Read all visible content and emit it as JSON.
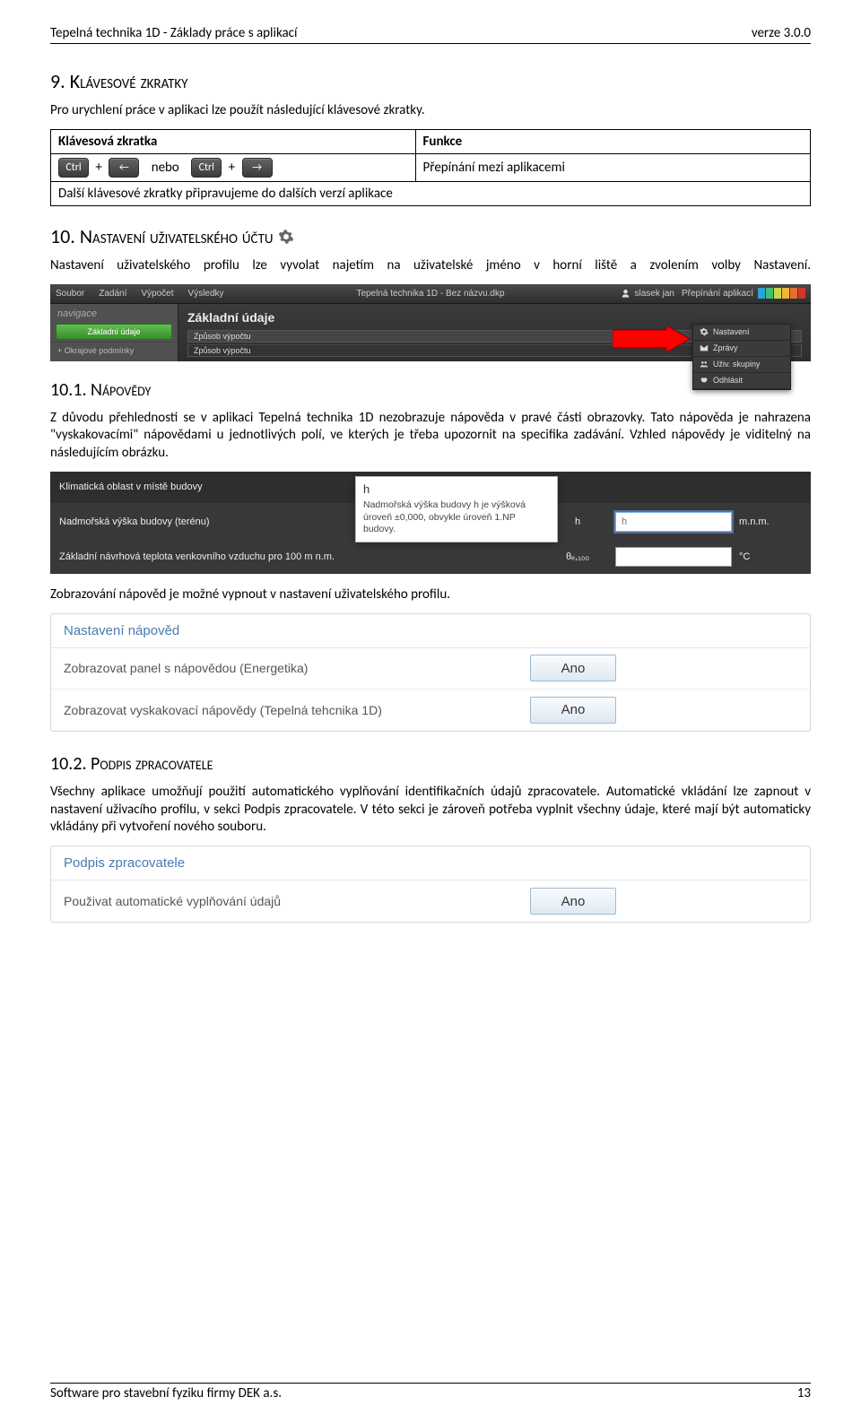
{
  "header": {
    "left": "Tepelná technika 1D - Základy práce s aplikací",
    "right": "verze 3.0.0"
  },
  "sec9": {
    "num": "9.",
    "title": "Klávesové zkratky",
    "intro": "Pro urychlení práce v aplikaci lze použít následující klávesové zkratky.",
    "table": {
      "h1": "Klávesová zkratka",
      "h2": "Funkce",
      "ctrl": "Ctrl",
      "left": "←",
      "right": "→",
      "or": "nebo",
      "fn": "Přepínání mezi aplikacemi",
      "note": "Další klávesové zkratky připravujeme do dalších verzí aplikace"
    }
  },
  "sec10": {
    "num": "10.",
    "title": "Nastavení uživatelského účtu",
    "intro": "Nastavení uživatelského profilu lze vyvolat najetím na uživatelské jméno v horní liště a zvolením volby Nastavení."
  },
  "shot1": {
    "menus": [
      "Soubor",
      "Zadání",
      "Výpočet",
      "Výsledky"
    ],
    "titlecenter": "Tepelná technika 1D - Bez názvu.dkp",
    "user": "slasek jan",
    "appswitch": "Přepínání aplikací",
    "swatches": [
      "#2ea3d9",
      "#3fbf72",
      "#c8d84a",
      "#f1b637",
      "#e86e2c",
      "#d2352f"
    ],
    "nav_label": "navigace",
    "nav_btn": "Základní údaje",
    "nav_line": "+ Okrajové podmínky",
    "main_title": "Základní údaje",
    "main_sub1": "Způsob výpočtu",
    "main_sub2": "Způsob výpočtu",
    "dropdown": [
      "Nastavení",
      "Zprávy",
      "Uživ. skupiny",
      "Odhlásit"
    ]
  },
  "sec101": {
    "num": "10.1.",
    "title": "Nápovědy",
    "p1": "Z důvodu přehlednosti se v aplikaci Tepelná technika 1D nezobrazuje nápověda v pravé části obrazovky. Tato nápověda je nahrazena \"vyskakovacími\" nápovědami u jednotlivých polí, ve kterých je třeba upozornit na specifika zadávání. Vzhled nápovědy je viditelný na následujícím obrázku."
  },
  "shot2": {
    "r1": "Klimatická oblast v místě budovy",
    "r2": "Nadmořská výška budovy (terénu)",
    "r3": "Základní návrhová teplota venkovního vzduchu pro 100 m n.m.",
    "sym_h": "h",
    "unit_h": "m.n.m.",
    "sym_t": "θₑ,₁₀₀",
    "unit_t": "°C",
    "tooltip_head": "h",
    "tooltip_body": "Nadmořská výška budovy h je výšková úroveň ±0,000, obvykle úroveň 1.NP budovy.",
    "input_placeholder": "h"
  },
  "after_shot2": "Zobrazování nápověd je možné vypnout v nastavení uživatelského profilu.",
  "panel1": {
    "head": "Nastavení nápověd",
    "rows": [
      {
        "label": "Zobrazovat panel s nápovědou (Energetika)",
        "btn": "Ano"
      },
      {
        "label": "Zobrazovat vyskakovací nápovědy (Tepelná tehcnika 1D)",
        "btn": "Ano"
      }
    ]
  },
  "sec102": {
    "num": "10.2.",
    "title": "Podpis zpracovatele",
    "p1": "Všechny aplikace umožňují použití automatického vyplňování identifikačních údajů zpracovatele. Automatické vkládání lze zapnout v nastavení uživacího profilu, v sekci Podpis zpracovatele. V této sekci je zároveň potřeba vyplnit všechny údaje, které mají být automaticky vkládány při vytvoření nového souboru."
  },
  "panel2": {
    "head": "Podpis zpracovatele",
    "rows": [
      {
        "label": "Použivat automatické vyplňování údajů",
        "btn": "Ano"
      }
    ]
  },
  "footer": {
    "left": "Software pro stavební fyziku firmy DEK a.s.",
    "right": "13"
  }
}
